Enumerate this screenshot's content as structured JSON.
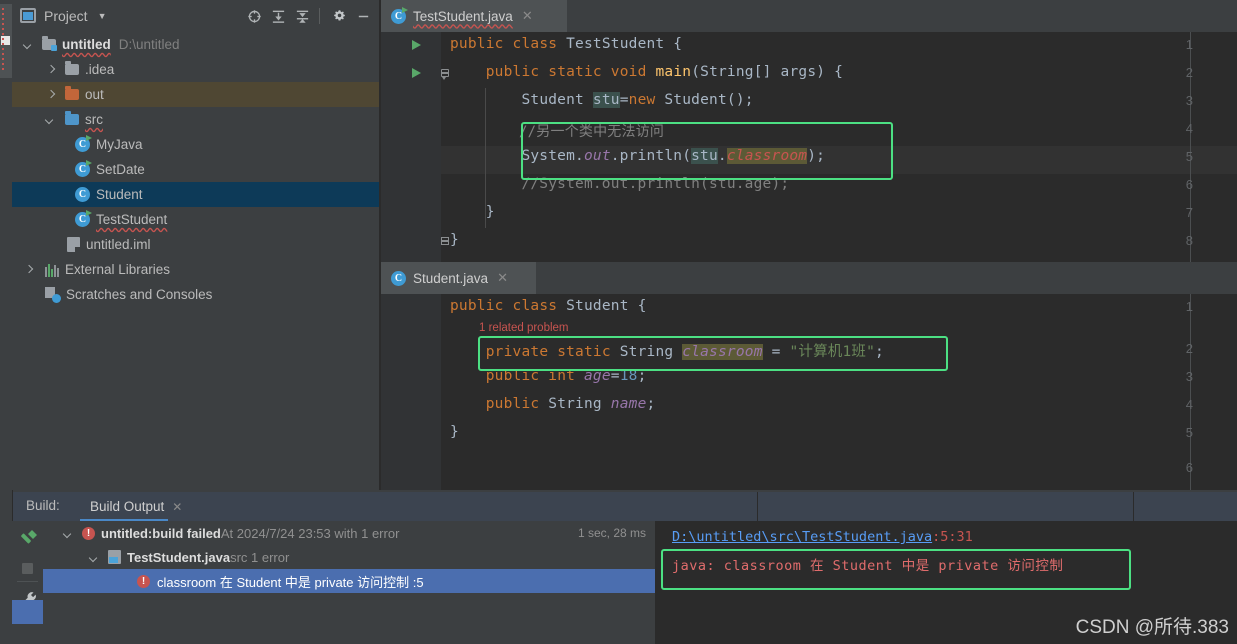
{
  "app": {
    "ide": "IntelliJ IDEA"
  },
  "project_panel": {
    "title": "Project",
    "caret_icon": "chevron-down-icon",
    "window_icon": "project-window-icon",
    "toolbar": [
      {
        "name": "select-opened-file-icon",
        "label": "target-icon"
      },
      {
        "name": "expand-all-icon",
        "label": "expand-all"
      },
      {
        "name": "collapse-all-icon",
        "label": "collapse-all"
      },
      {
        "name": "settings-gear-icon",
        "label": "gear"
      },
      {
        "name": "hide-icon",
        "label": "minus"
      }
    ],
    "tree": [
      {
        "label": "untitled",
        "path": "D:\\untitled",
        "icon": "module-folder-icon",
        "expanded": true,
        "indent": 0,
        "bold": true,
        "wavy": true,
        "state": "normal"
      },
      {
        "label": ".idea",
        "icon": "folder-icon",
        "expanded": false,
        "indent": 1,
        "state": "normal"
      },
      {
        "label": "out",
        "icon": "excluded-folder-icon",
        "expanded": false,
        "indent": 1,
        "state": "olive"
      },
      {
        "label": "src",
        "icon": "source-folder-icon",
        "expanded": true,
        "indent": 1,
        "wavy": true,
        "state": "normal"
      },
      {
        "label": "MyJava",
        "icon": "java-runnable-class-icon",
        "indent": 2,
        "state": "normal"
      },
      {
        "label": "SetDate",
        "icon": "java-runnable-class-icon",
        "indent": 2,
        "state": "normal"
      },
      {
        "label": "Student",
        "icon": "java-class-icon",
        "indent": 2,
        "state": "selected"
      },
      {
        "label": "TestStudent",
        "icon": "java-runnable-class-icon",
        "indent": 2,
        "wavy": true,
        "state": "normal"
      },
      {
        "label": "untitled.iml",
        "icon": "iml-file-icon",
        "indent": 1,
        "state": "normal"
      },
      {
        "label": "External Libraries",
        "icon": "libraries-icon",
        "expanded": false,
        "indent": 0,
        "state": "normal"
      },
      {
        "label": "Scratches and Consoles",
        "icon": "scratches-icon",
        "indent": 0,
        "state": "normal"
      }
    ]
  },
  "editor_top": {
    "tab": {
      "label": "TestStudent.java",
      "icon": "java-runnable-class-icon",
      "close_icon": "close-icon",
      "active": true
    },
    "line_numbers": [
      "1",
      "2",
      "3",
      "4",
      "5",
      "6",
      "7",
      "8"
    ],
    "gutter_run_lines": [
      1,
      2
    ],
    "highlight_line": 5,
    "code": [
      {
        "n": 1,
        "text": "public class TestStudent {"
      },
      {
        "n": 2,
        "text": "    public static void main(String[] args) {"
      },
      {
        "n": 3,
        "text": "        Student stu=new Student();"
      },
      {
        "n": 4,
        "text": "        //另一个类中无法访问"
      },
      {
        "n": 5,
        "text": "        System.out.println(stu.classroom);"
      },
      {
        "n": 6,
        "text": "        //System.out.println(stu.age);"
      },
      {
        "n": 7,
        "text": "    }"
      },
      {
        "n": 8,
        "text": "}"
      }
    ],
    "annotation_box": {
      "name": "green-highlight-box",
      "lines": [
        4,
        5
      ]
    }
  },
  "editor_bottom": {
    "tab": {
      "label": "Student.java",
      "icon": "java-class-icon",
      "close_icon": "close-icon",
      "active": true
    },
    "line_numbers": [
      "1",
      "2",
      "3",
      "4",
      "5",
      "6"
    ],
    "inlay_hint": "1 related problem",
    "code": [
      {
        "n": 1,
        "text": "public class Student {"
      },
      {
        "n": 2,
        "text": "    private static String classroom = \"计算机1班\";"
      },
      {
        "n": 3,
        "text": "    public int age=18;"
      },
      {
        "n": 4,
        "text": "    public String name;"
      },
      {
        "n": 5,
        "text": "}"
      },
      {
        "n": 6,
        "text": ""
      }
    ],
    "annotation_box": {
      "name": "green-highlight-box",
      "lines": [
        2
      ]
    }
  },
  "build_panel": {
    "label": "Build:",
    "tab": {
      "label": "Build Output",
      "close_icon": "close-icon"
    },
    "sidebar": [
      {
        "name": "rebuild-hammer-icon"
      },
      {
        "name": "stop-icon"
      },
      {
        "name": "settings-wrench-icon"
      }
    ],
    "tree": [
      {
        "indent": 0,
        "icon": "error-icon",
        "expanded": true,
        "bold_text": "untitled:",
        "text": " build failed ",
        "gray_text": "At 2024/7/24 23:53 with 1 error",
        "time": "1 sec, 28 ms",
        "selected": false
      },
      {
        "indent": 1,
        "icon": "java-file-icon",
        "expanded": true,
        "bold_text": "TestStudent.java",
        "text": "",
        "gray_text": " src 1 error",
        "selected": false
      },
      {
        "indent": 2,
        "icon": "error-icon",
        "bold_text": "",
        "text": "classroom 在 Student 中是 private 访问控制 :5",
        "gray_text": "",
        "selected": true
      }
    ],
    "detail": {
      "path_link": "D:\\untitled\\src\\TestStudent.java",
      "path_pos": ":5:31",
      "message": "java: classroom 在 Student 中是 private 访问控制",
      "annotation_box": {
        "name": "green-highlight-box"
      }
    },
    "watermark": "CSDN @所待.383"
  },
  "colors": {
    "accent_green_box": "#4ce083",
    "selection_blue": "#4b6eaf",
    "tree_selection": "#0d3a58",
    "error_red": "#c75450",
    "keyword_orange": "#cc7832",
    "string_green": "#6a8759",
    "field_purple": "#9876aa",
    "method_yellow": "#ffc66d",
    "number_blue": "#6897bb"
  }
}
